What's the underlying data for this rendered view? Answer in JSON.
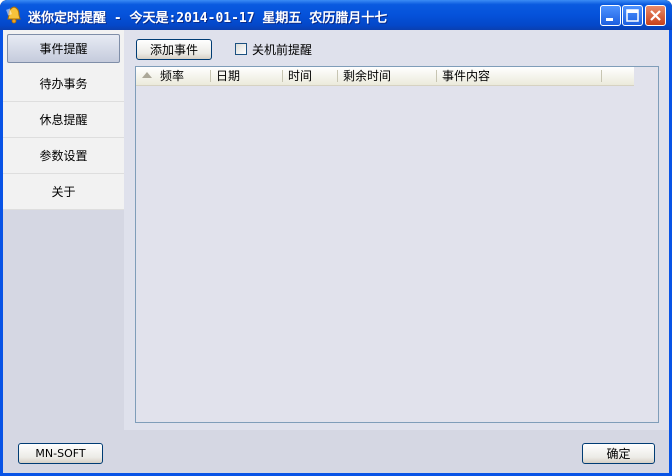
{
  "window": {
    "title": "迷你定时提醒 - 今天是:2014-01-17 星期五 农历腊月十七"
  },
  "sidebar": {
    "items": [
      {
        "label": "事件提醒",
        "active": true
      },
      {
        "label": "待办事务",
        "active": false
      },
      {
        "label": "休息提醒",
        "active": false
      },
      {
        "label": "参数设置",
        "active": false
      },
      {
        "label": "关于",
        "active": false
      }
    ]
  },
  "toolbar": {
    "add_event_label": "添加事件",
    "shutdown_remind_label": "关机前提醒",
    "shutdown_remind_checked": false
  },
  "list": {
    "columns": [
      "频率",
      "日期",
      "时间",
      "剩余时间",
      "事件内容"
    ],
    "rows": []
  },
  "footer": {
    "brand_label": "MN-SOFT",
    "ok_label": "确定"
  },
  "colors": {
    "titlebar": "#0552da",
    "client_bg": "#dfe1ec",
    "sidebar_bg": "#f2f2f2"
  }
}
